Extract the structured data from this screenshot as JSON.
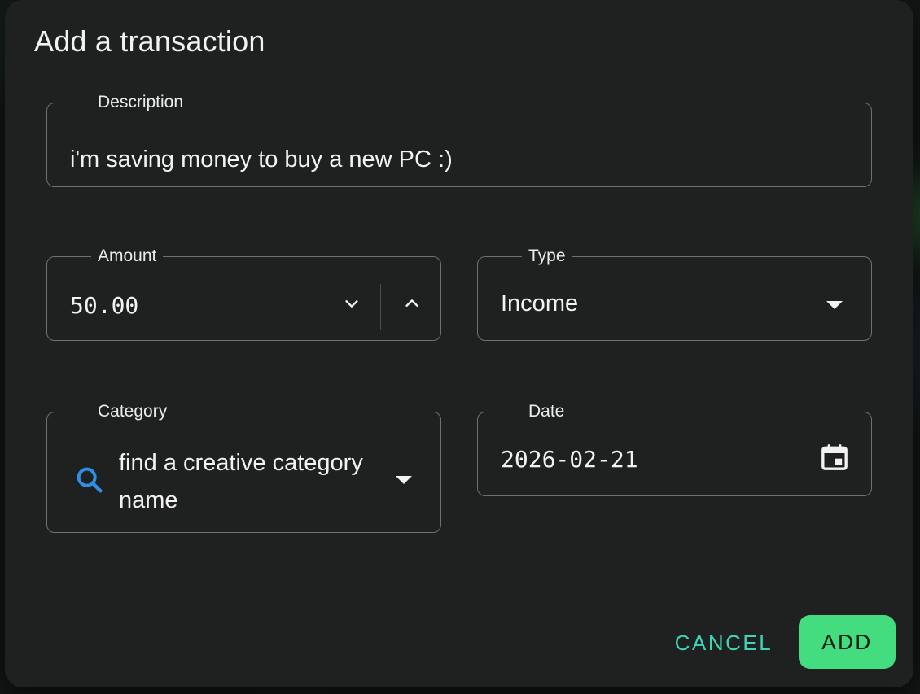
{
  "dialog": {
    "title": "Add a transaction"
  },
  "fields": {
    "description": {
      "label": "Description",
      "value": "i'm saving money to buy a new PC :)"
    },
    "amount": {
      "label": "Amount",
      "value": "50.00"
    },
    "type": {
      "label": "Type",
      "value": "Income"
    },
    "category": {
      "label": "Category",
      "value": "find a creative category name",
      "icon": "search-icon"
    },
    "date": {
      "label": "Date",
      "value": "2026-02-21",
      "icon": "calendar-icon"
    }
  },
  "actions": {
    "cancel_label": "CANCEL",
    "add_label": "ADD"
  },
  "colors": {
    "accent_teal": "#3fd4b6",
    "accent_green": "#43dd7f",
    "search_icon_blue": "#2f8fe6"
  }
}
